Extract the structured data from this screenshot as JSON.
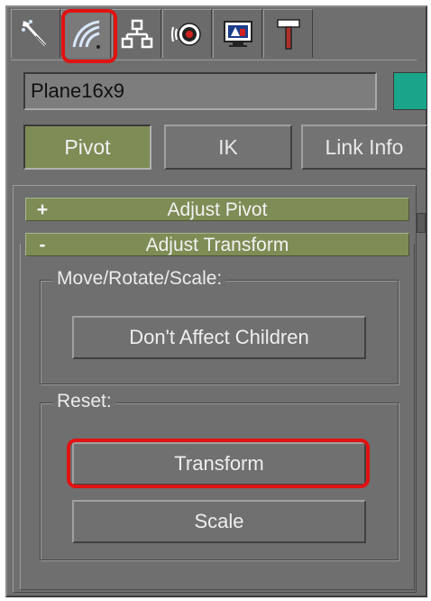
{
  "tabs": [
    {
      "icon": "create-icon",
      "active": false
    },
    {
      "icon": "modify-icon",
      "active": true
    },
    {
      "icon": "hierarchy-icon",
      "active": false
    },
    {
      "icon": "motion-icon",
      "active": false
    },
    {
      "icon": "display-icon",
      "active": false
    },
    {
      "icon": "utilities-hammer-icon",
      "active": false
    }
  ],
  "object": {
    "name": "Plane16x9",
    "color": "#18a58a"
  },
  "modes": {
    "pivot": "Pivot",
    "ik": "IK",
    "link_info": "Link Info"
  },
  "rollouts": {
    "adjust_pivot": {
      "sign": "+",
      "title": "Adjust Pivot"
    },
    "adjust_transform": {
      "sign": "-",
      "title": "Adjust Transform"
    }
  },
  "groups": {
    "move_rotate_scale": {
      "label": "Move/Rotate/Scale:",
      "button": "Don't Affect Children"
    },
    "reset": {
      "label": "Reset:",
      "transform_button": "Transform",
      "scale_button": "Scale"
    }
  },
  "colors": {
    "panel": "#6f6f6f",
    "active_green": "#7e8c55",
    "highlight_red": "#e11212"
  }
}
